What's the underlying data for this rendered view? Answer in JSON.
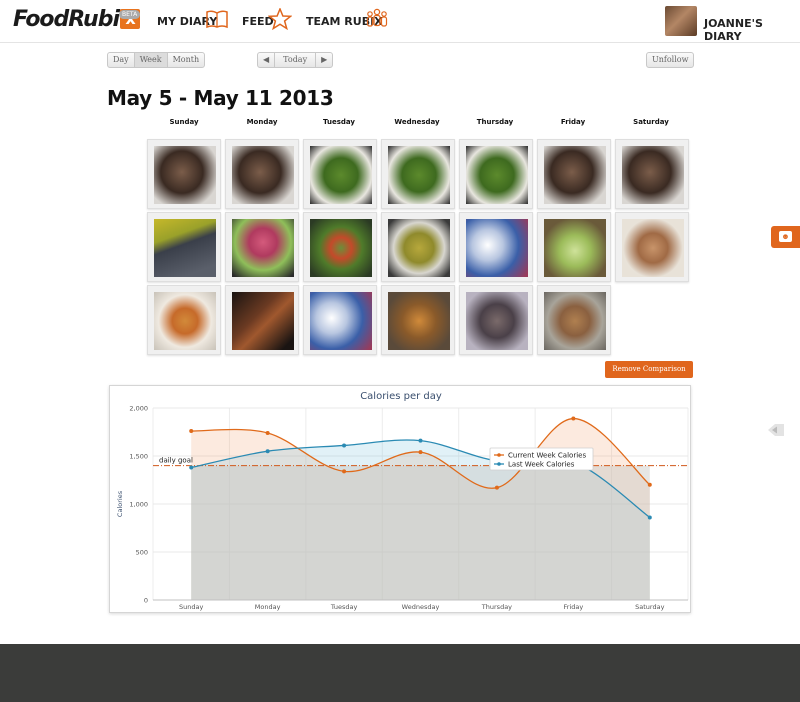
{
  "app": {
    "logo_text": "FoodRubi",
    "logo_x": "x",
    "beta_label": "BETA"
  },
  "nav": {
    "my_diary": "MY DIARY",
    "feed": "FEED",
    "team": "TEAM RUBIX",
    "user_label": "JOANNE'S DIARY"
  },
  "toolbar": {
    "day": "Day",
    "week": "Week",
    "month": "Month",
    "prev": "◀",
    "today": "Today",
    "next": "▶",
    "unfollow": "Unfollow"
  },
  "date_range": "May 5 - May 11 2013",
  "days": [
    "Sunday",
    "Monday",
    "Tuesday",
    "Wednesday",
    "Thursday",
    "Friday",
    "Saturday"
  ],
  "photos": [
    [
      "dessert-dark",
      "dessert-dark",
      "salad-greens",
      "salad-greens",
      "salad-greens",
      "dessert-dark",
      "dessert-dark"
    ],
    [
      "krave-jerky",
      "salad-beet",
      "salad-mixed",
      "bowl-beans",
      "week-card",
      "salad-lettuce",
      "pastry-plate"
    ],
    [
      "soup-bowl",
      "cinnamon-dessert",
      "week-card",
      "shrimp-stirfry",
      "glass-jar",
      "container-chicken",
      ""
    ]
  ],
  "remove_comparison": "Remove Comparison",
  "colors": {
    "accent": "#e0661d",
    "current_week": "#e06a1a",
    "last_week": "#2a8ab3",
    "footer": "#3b3c3a"
  },
  "chart_data": {
    "type": "line",
    "title": "Calories per day",
    "ylabel": "Calories",
    "xlabel": "",
    "categories": [
      "Sunday",
      "Monday",
      "Tuesday",
      "Wednesday",
      "Thursday",
      "Friday",
      "Saturday"
    ],
    "ylim": [
      0,
      2000
    ],
    "yticks": [
      "0",
      "500",
      "1,000",
      "1,500",
      "2,000"
    ],
    "series": [
      {
        "name": "Current Week Calories",
        "values": [
          1760,
          1740,
          1340,
          1540,
          1170,
          1890,
          1200
        ]
      },
      {
        "name": "Last Week Calories",
        "values": [
          1380,
          1550,
          1610,
          1660,
          1450,
          1440,
          860
        ]
      }
    ],
    "goal": {
      "label": "daily goal",
      "value": 1400
    },
    "legend_position": "center-right",
    "grid": true
  }
}
